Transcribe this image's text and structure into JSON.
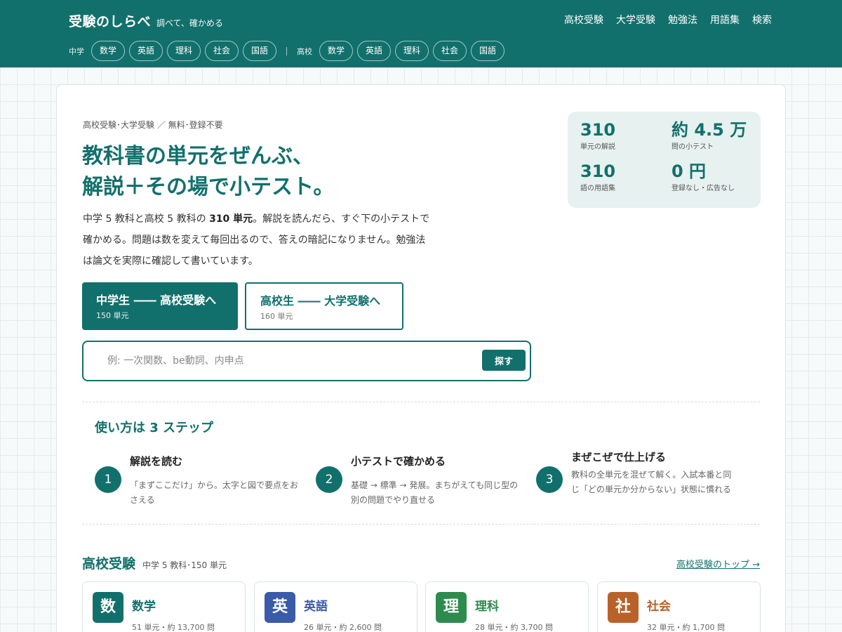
{
  "brand": {
    "name": "受験のしらべ",
    "tagline": "調べて、確かめる"
  },
  "topnav": [
    "高校受験",
    "大学受験",
    "勉強法",
    "用語集",
    "検索"
  ],
  "subjects": {
    "junior_label": "中学",
    "junior": [
      "数学",
      "英語",
      "理科",
      "社会",
      "国語"
    ],
    "senior_label": "高校",
    "senior": [
      "数学",
      "英語",
      "理科",
      "社会",
      "国語"
    ]
  },
  "hero": {
    "crumb": "高校受験･大学受験 ／ 無料･登録不要",
    "headline_line1": "教科書の単元をぜんぶ、",
    "headline_line2": "解説＋その場で小テスト。",
    "intro_pre": "中学 5 教科と高校 5 教科の ",
    "intro_bold": "310 単元",
    "intro_post": "。解説を読んだら、すぐ下の小テストで確かめる。問題は数を変えて毎回出るので、答えの暗記になりません。勉強法は論文を実際に確認して書いています。"
  },
  "stats": [
    {
      "value": "310",
      "label": "単元の解説"
    },
    {
      "value": "約 4.5 万",
      "label": "問の小テスト"
    },
    {
      "value": "310",
      "label": "語の用語集"
    },
    {
      "value": "0 円",
      "label": "登録なし・広告なし"
    }
  ],
  "cta": {
    "primary_title": "中学生 ―― 高校受験へ",
    "primary_sub": "150 単元",
    "secondary_title": "高校生 ―― 大学受験へ",
    "secondary_sub": "160 単元"
  },
  "search": {
    "placeholder": "例: 一次関数、be動詞、内申点",
    "button": "探す"
  },
  "howto": {
    "title": "使い方は 3 ステップ",
    "steps": [
      {
        "num": "1",
        "title": "解説を読む",
        "desc": "「まずここだけ」から。太字と図で要点をおさえる"
      },
      {
        "num": "2",
        "title": "小テストで確かめる",
        "desc": "基礎 → 標準 → 発展。まちがえても同じ型の別の問題でやり直せる"
      },
      {
        "num": "3",
        "title": "まぜこぜで仕上げる",
        "desc": "教科の全単元を混ぜて解く。入試本番と同じ「どの単元か分からない」状態に慣れる"
      }
    ]
  },
  "koko": {
    "title": "高校受験",
    "subtitle": "中学 5 教科･150 単元",
    "link": "高校受験のトップ →",
    "cards": [
      {
        "icon": "数",
        "name": "数学",
        "meta": "51 単元・約 13,700 問",
        "color": "#12706c"
      },
      {
        "icon": "英",
        "name": "英語",
        "meta": "26 単元・約 2,600 問",
        "color": "#3a5ba8"
      },
      {
        "icon": "理",
        "name": "理科",
        "meta": "28 単元・約 3,700 問",
        "color": "#2e8b4e"
      },
      {
        "icon": "社",
        "name": "社会",
        "meta": "32 単元・約 1,700 問",
        "color": "#b8622a"
      }
    ]
  }
}
